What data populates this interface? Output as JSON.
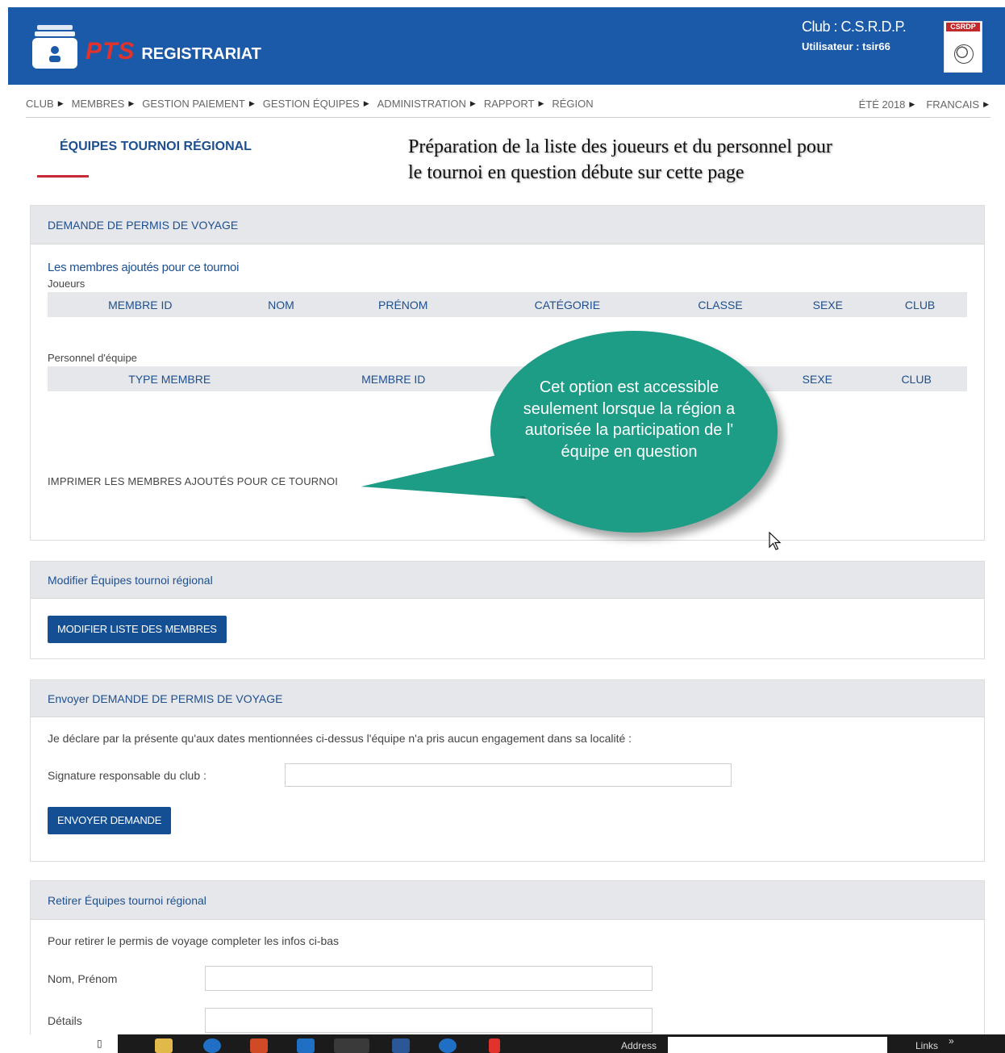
{
  "header": {
    "brand_pts": "PTS",
    "brand_registrariat": "REGISTRARIAT",
    "club": "Club : C.S.R.D.P.",
    "user": "Utilisateur : tsir66",
    "club_logo_text": "CSRDP"
  },
  "nav": {
    "items": [
      "CLUB",
      "MEMBRES",
      "GESTION PAIEMENT",
      "GESTION ÉQUIPES",
      "ADMINISTRATION",
      "RAPPORT",
      "RÉGION"
    ],
    "season": "ÉTÉ 2018",
    "language": "FRANCAIS"
  },
  "page": {
    "title": "ÉQUIPES TOURNOI RÉGIONAL",
    "annotation": "Préparation de la liste des joueurs et du personnel pour le tournoi en question débute sur cette page"
  },
  "permit_panel": {
    "heading": "DEMANDE DE PERMIS DE VOYAGE",
    "members_title": "Les membres ajoutés pour ce tournoi",
    "players_label": "Joueurs",
    "player_columns": [
      "MEMBRE ID",
      "NOM",
      "PRÉNOM",
      "CATÉGORIE",
      "CLASSE",
      "SEXE",
      "CLUB"
    ],
    "staff_label": "Personnel d'équipe",
    "staff_columns": [
      "TYPE MEMBRE",
      "MEMBRE ID",
      "SEXE",
      "CLUB"
    ],
    "print_link": "IMPRIMER LES MEMBRES AJOUTÉS POUR CE TOURNOI"
  },
  "callout": {
    "text": "Cet option est accessible seulement lorsque la région a autorisée la participation de l' équipe en question"
  },
  "modify_panel": {
    "heading": "Modifier Équipes tournoi régional",
    "button": "MODIFIER LISTE DES MEMBRES"
  },
  "send_panel": {
    "heading": "Envoyer DEMANDE DE PERMIS DE VOYAGE",
    "declaration": "Je déclare par la présente qu'aux dates mentionnées ci-dessus l'équipe n'a pris aucun engagement dans sa localité :",
    "signature_label": "Signature responsable du club :",
    "signature_value": "",
    "button": "ENVOYER DEMANDE"
  },
  "withdraw_panel": {
    "heading": "Retirer Équipes tournoi régional",
    "instructions": "Pour retirer le permis de voyage completer les infos ci-bas",
    "name_label": "Nom, Prénom",
    "name_value": "",
    "details_label": "Détails",
    "details_value": ""
  },
  "taskbar": {
    "address_label": "Address",
    "links_label": "Links",
    "overflow": "»"
  },
  "colors": {
    "brand_blue": "#1b5aa9",
    "button_blue": "#154f93",
    "accent_red": "#c82a35",
    "callout_green": "#1d9c86"
  }
}
